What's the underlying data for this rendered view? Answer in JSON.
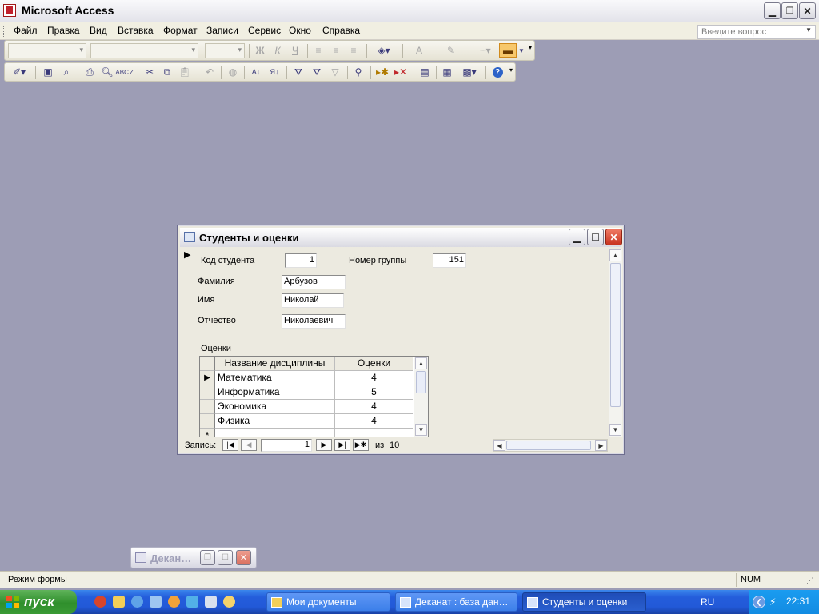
{
  "app": {
    "title": "Microsoft Access"
  },
  "menu": {
    "items": [
      "Файл",
      "Правка",
      "Вид",
      "Вставка",
      "Формат",
      "Записи",
      "Сервис",
      "Окно",
      "Справка"
    ],
    "ask_placeholder": "Введите вопрос"
  },
  "toolbar_format": {
    "bold": "Ж",
    "italic": "К",
    "underline": "Ч",
    "font_color_glyph": "A"
  },
  "form": {
    "title": "Студенты и оценки",
    "fields": {
      "student_id_label": "Код студента",
      "student_id_value": "1",
      "group_label": "Номер группы",
      "group_value": "151",
      "surname_label": "Фамилия",
      "surname_value": "Арбузов",
      "name_label": "Имя",
      "name_value": "Николай",
      "patronymic_label": "Отчество",
      "patronymic_value": "Николаевич"
    },
    "subform": {
      "label": "Оценки",
      "columns": [
        "Название дисциплины",
        "Оценки"
      ],
      "rows": [
        {
          "discipline": "Математика",
          "grade": "4"
        },
        {
          "discipline": "Информатика",
          "grade": "5"
        },
        {
          "discipline": "Экономика",
          "grade": "4"
        },
        {
          "discipline": "Физика",
          "grade": "4"
        }
      ],
      "new_row_glyph": "*"
    },
    "nav": {
      "label": "Запись:",
      "current": "1",
      "of_label": "из",
      "total": "10"
    }
  },
  "minimized_window": {
    "title": "Декан…"
  },
  "status": {
    "left": "Режим формы",
    "num": "NUM"
  },
  "taskbar": {
    "start": "пуск",
    "tasks": [
      "Мои документы",
      "Деканат : база дан…",
      "Студенты и оценки"
    ],
    "lang": "RU",
    "time": "22:31"
  },
  "colors": {
    "mdi_background": "#9d9db5",
    "taskbar_blue": "#245ddb",
    "start_green": "#2f8f2c",
    "close_red": "#d9412f"
  }
}
